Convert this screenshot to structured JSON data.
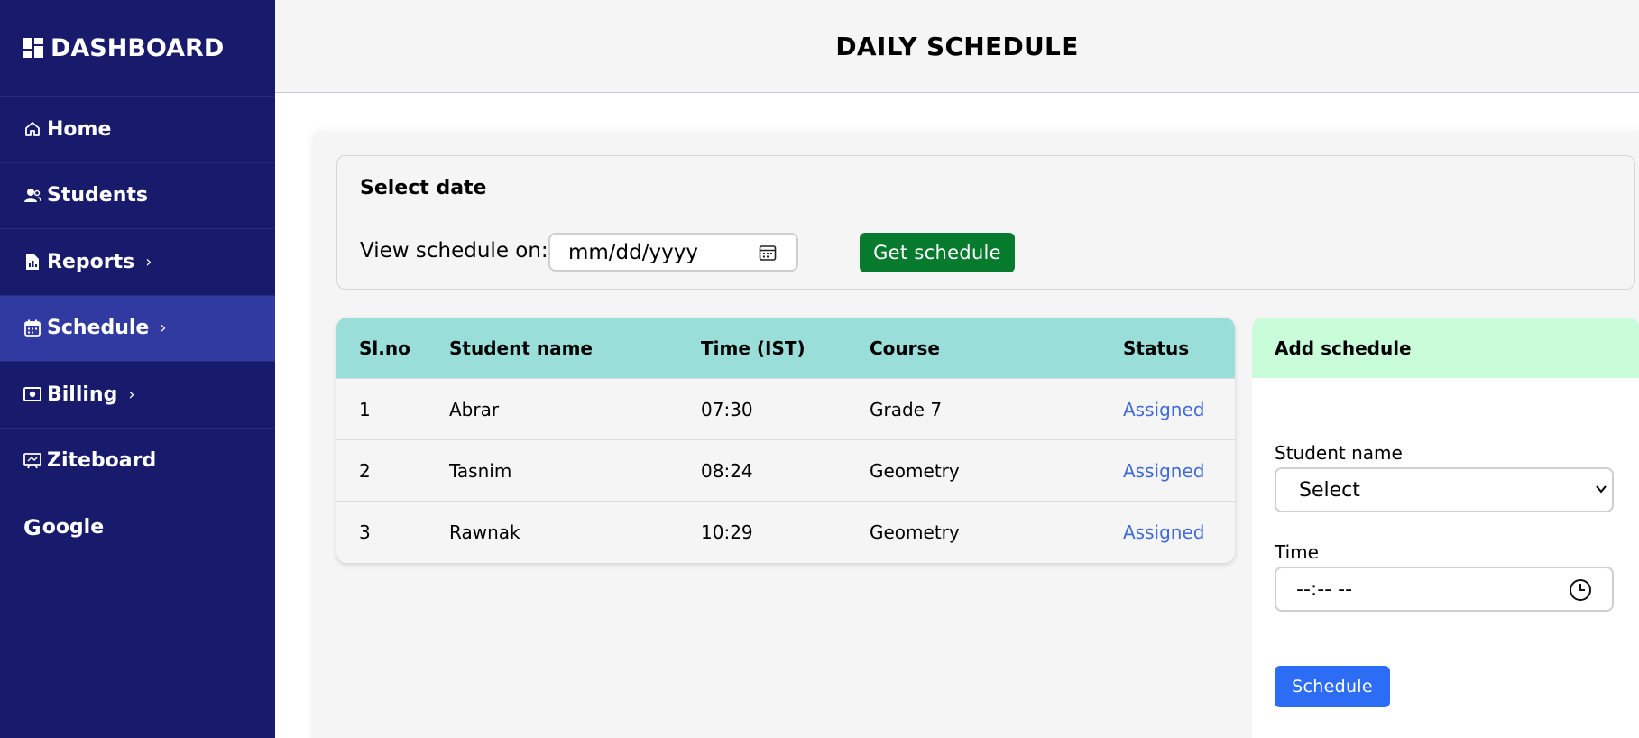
{
  "sidebar": {
    "brand": "DASHBOARD",
    "items": [
      {
        "label": "Home",
        "icon": "home-icon",
        "chevron": ""
      },
      {
        "label": "Students",
        "icon": "students-icon",
        "chevron": ""
      },
      {
        "label": "Reports",
        "icon": "report-icon",
        "chevron": "›"
      },
      {
        "label": "Schedule",
        "icon": "calendar-icon",
        "chevron": "›"
      },
      {
        "label": "Billing",
        "icon": "billing-icon",
        "chevron": "›"
      },
      {
        "label": "Ziteboard",
        "icon": "whiteboard-icon",
        "chevron": ""
      },
      {
        "label": "oogle",
        "icon": "google-icon",
        "chevron": ""
      }
    ],
    "google_letter": "G",
    "active_item": "Schedule"
  },
  "header": {
    "title": "DAILY SCHEDULE"
  },
  "date_section": {
    "title": "Select date",
    "label": "View schedule on:",
    "date_placeholder": "mm/dd/yyyy",
    "button": "Get schedule"
  },
  "table": {
    "columns": [
      "Sl.no",
      "Student name",
      "Time (IST)",
      "Course",
      "Status"
    ],
    "rows": [
      [
        "1",
        "Abrar",
        "07:30",
        "Grade 7",
        "Assigned"
      ],
      [
        "2",
        "Tasnim",
        "08:24",
        "Geometry",
        "Assigned"
      ],
      [
        "3",
        "Rawnak",
        "10:29",
        "Geometry",
        "Assigned"
      ]
    ]
  },
  "add_schedule": {
    "title": "Add schedule",
    "student_label": "Student name",
    "student_value": "Select",
    "time_label": "Time",
    "time_placeholder": "--:-- --",
    "button": "Schedule"
  },
  "colors": {
    "sidebar_bg": "#181b6b",
    "sidebar_active": "#303aa0",
    "table_header": "#99ded8",
    "add_header": "#c9fcd8",
    "get_button": "#067b2e",
    "schedule_button": "#2d6df6",
    "status_text": "#3f6ad8"
  }
}
